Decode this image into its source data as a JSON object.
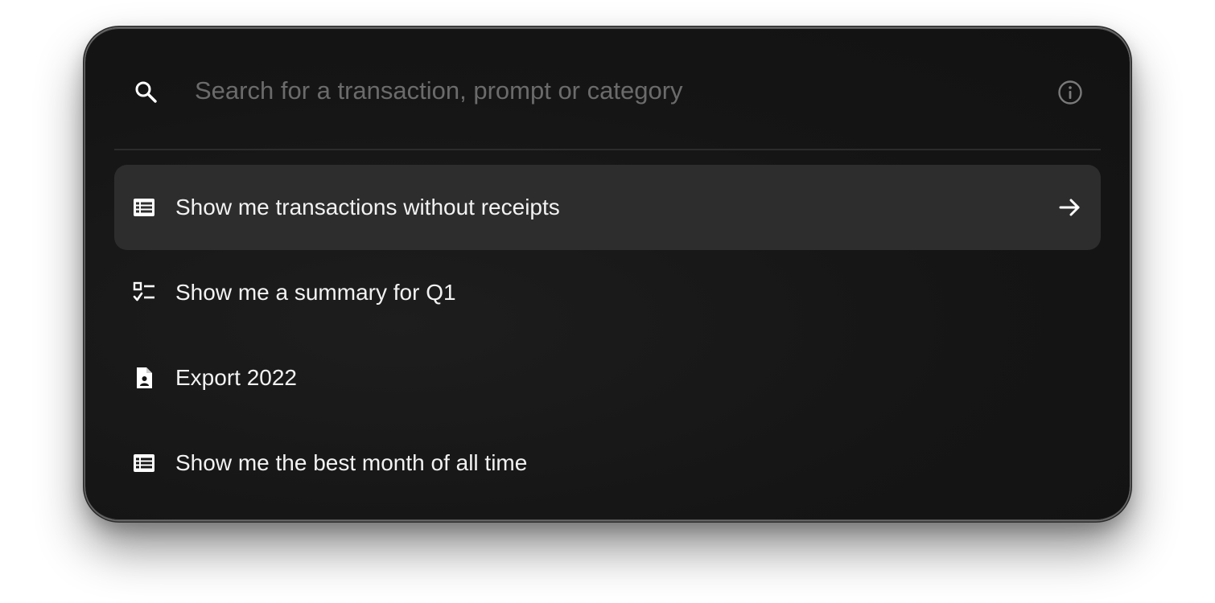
{
  "search": {
    "placeholder": "Search for a transaction, prompt or category",
    "icon": "search-icon",
    "info_icon": "info-icon"
  },
  "suggestions": [
    {
      "label": "Show me transactions without receipts",
      "icon": "table-list-icon",
      "selected": true
    },
    {
      "label": "Show me a summary for Q1",
      "icon": "checklist-icon",
      "selected": false
    },
    {
      "label": "Export 2022",
      "icon": "contact-file-icon",
      "selected": false
    },
    {
      "label": "Show me the best month of all time",
      "icon": "table-list-icon",
      "selected": false
    }
  ],
  "colors": {
    "panel_background": "#151515",
    "selected_row": "#2d2d2d",
    "text": "#f2f2f2",
    "placeholder": "#6b6b6b",
    "divider": "#2c2c2c"
  }
}
